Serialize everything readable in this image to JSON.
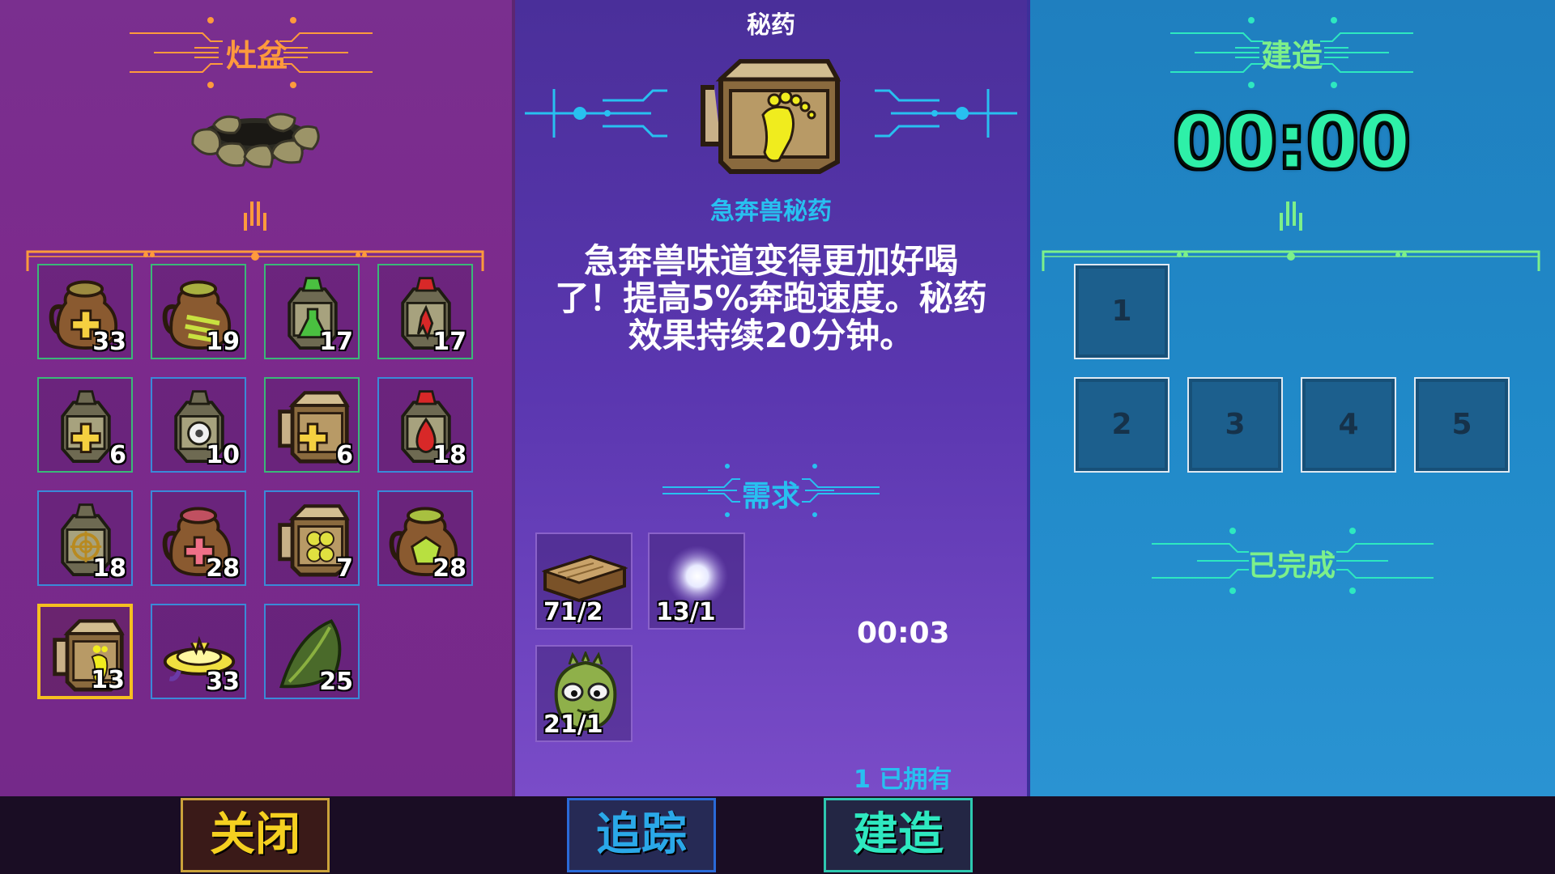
{
  "left": {
    "title": "灶盆",
    "inventory": [
      {
        "icon": "brown-jug-yellow-cross-icon",
        "count": "33"
      },
      {
        "icon": "brown-jug-green-stripes-icon",
        "count": "19"
      },
      {
        "icon": "lantern-green-potion-icon",
        "count": "17"
      },
      {
        "icon": "lantern-red-potion-icon",
        "count": "17"
      },
      {
        "icon": "lantern-yellow-cross-icon",
        "count": "6"
      },
      {
        "icon": "lantern-white-gear-icon",
        "count": "10"
      },
      {
        "icon": "mug-yellow-cross-icon",
        "count": "6"
      },
      {
        "icon": "lantern-red-drop-icon",
        "count": "18"
      },
      {
        "icon": "lantern-target-icon",
        "count": "18"
      },
      {
        "icon": "brown-jug-pink-cross-icon",
        "count": "28"
      },
      {
        "icon": "mug-clover-icon",
        "count": "7"
      },
      {
        "icon": "brown-jug-lime-gem-icon",
        "count": "28"
      },
      {
        "icon": "mug-footprint-icon",
        "count": "13",
        "selected": true
      },
      {
        "icon": "yellow-saucer-icon",
        "count": "33"
      },
      {
        "icon": "green-leaf-icon",
        "count": "25"
      }
    ],
    "close_label": "关闭"
  },
  "mid": {
    "header": "秘药",
    "item_name": "急奔兽秘药",
    "description_lines": [
      "急奔兽味道变得更加好喝",
      "了！提高5%奔跑速度。秘药",
      "效果持续20分钟。"
    ],
    "requirements_title": "需求",
    "requirements": [
      {
        "icon": "wood-plank-icon",
        "count": "71/2"
      },
      {
        "icon": "glowing-orb-icon",
        "count": "13/1"
      },
      {
        "icon": "green-creature-icon",
        "count": "21/1"
      }
    ],
    "craft_time": "00:03",
    "owned": "1 已拥有",
    "track_label": "追踪",
    "build_label": "建造"
  },
  "right": {
    "title": "建造",
    "timer": "00:00",
    "queue_slots": [
      "1",
      "2",
      "3",
      "4",
      "5"
    ],
    "completed_title": "已完成"
  },
  "colors": {
    "left_accent": "#ff9a3c",
    "mid_accent": "#28c0f0",
    "right_accent": "#7df08a",
    "timer": "#2ef0a8",
    "close_text": "#f5d020",
    "track_text": "#2aa8e8",
    "build_text": "#2ee8c0"
  }
}
